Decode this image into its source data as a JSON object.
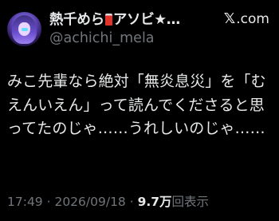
{
  "author": {
    "display_name_start": "熱千めら",
    "display_name_end": "アソビ★…",
    "handle": "@achichi_mela"
  },
  "brand": {
    "logo_letter": "𝕏",
    "label": ".com"
  },
  "tweet": {
    "text": "みこ先輩なら絶対「無炎息災」を「むえんいえん」って読んでくださると思ってたのじゃ……うれしいのじゃ……"
  },
  "meta": {
    "time": "17:49",
    "separator": " · ",
    "date": "2026/09/18",
    "views_count": "9.7万",
    "views_label": "回表示"
  }
}
